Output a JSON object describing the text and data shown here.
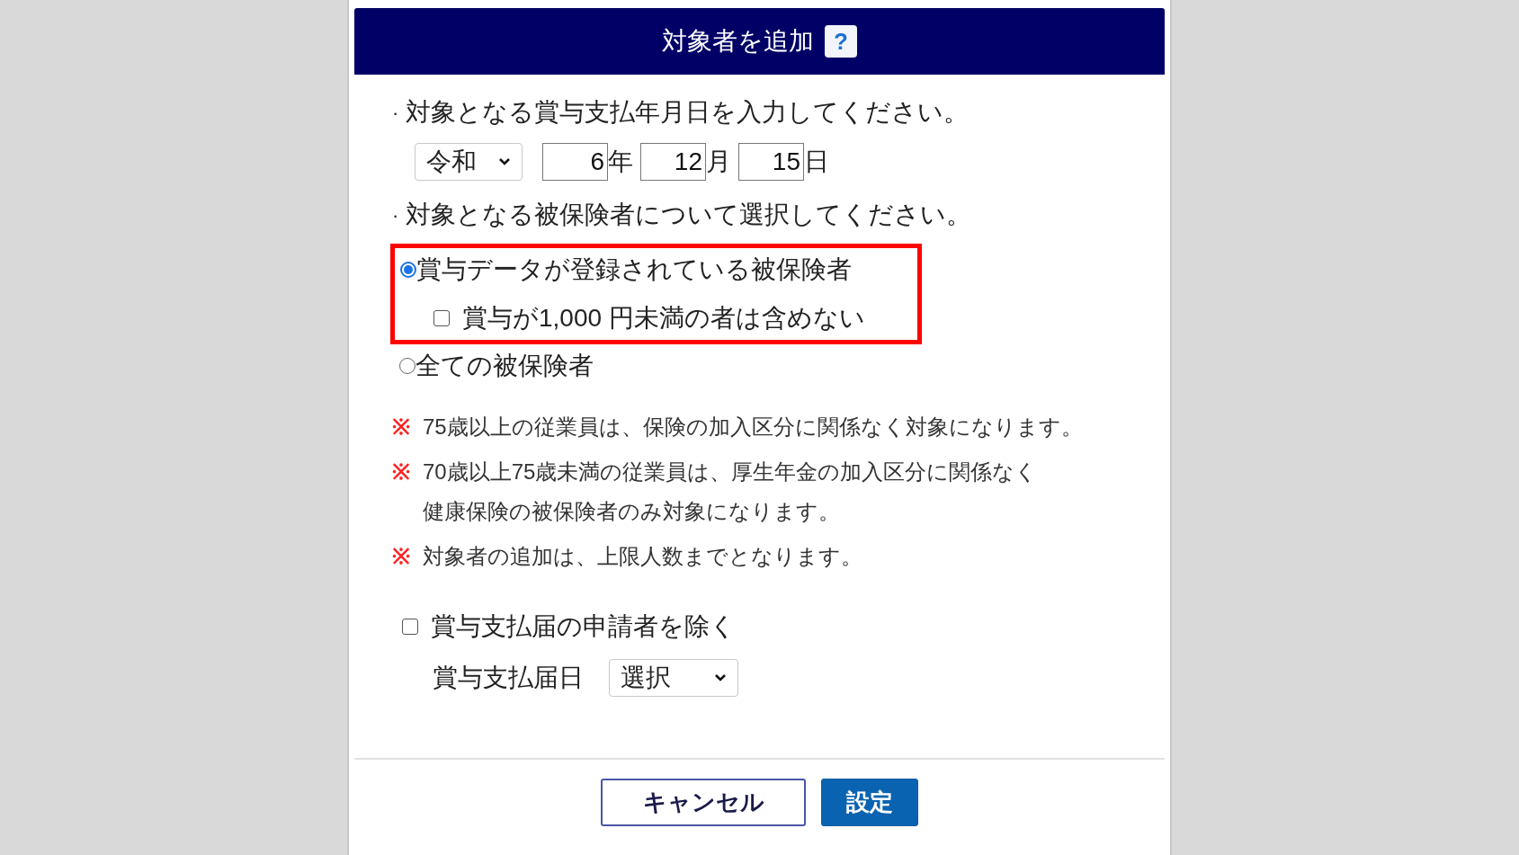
{
  "dialog": {
    "title": "対象者を追加",
    "help_label": "?"
  },
  "date_section": {
    "bullet": "·",
    "instruction": "対象となる賞与支払年月日を入力してください。",
    "era": "令和",
    "year": "6",
    "year_unit": "年",
    "month": "12",
    "month_unit": "月",
    "day": "15",
    "day_unit": "日"
  },
  "insured_section": {
    "bullet": "·",
    "instruction": "対象となる被保険者について選択してください。",
    "highlighted": true,
    "options": [
      {
        "label": "賞与データが登録されている被保険者",
        "selected": true,
        "sub_option": {
          "label": "賞与が1,000 円未満の者は含めない",
          "checked": false
        }
      },
      {
        "label": "全ての被保険者",
        "selected": false
      }
    ]
  },
  "notes": [
    {
      "mark": "※",
      "lines": [
        "75歳以上の従業員は、保険の加入区分に関係なく対象になります。"
      ]
    },
    {
      "mark": "※",
      "lines": [
        "70歳以上75歳未満の従業員は、厚生年金の加入区分に関係なく",
        "健康保険の被保険者のみ対象になります。"
      ]
    },
    {
      "mark": "※",
      "lines": [
        "対象者の追加は、上限人数までとなります。"
      ]
    }
  ],
  "exclude_applicant": {
    "label": "賞与支払届の申請者を除く",
    "checked": false
  },
  "notification_date": {
    "label": "賞与支払届日",
    "value": "選択"
  },
  "buttons": [
    {
      "label": "キャンセル",
      "kind": "secondary"
    },
    {
      "label": "設定",
      "kind": "primary"
    }
  ]
}
